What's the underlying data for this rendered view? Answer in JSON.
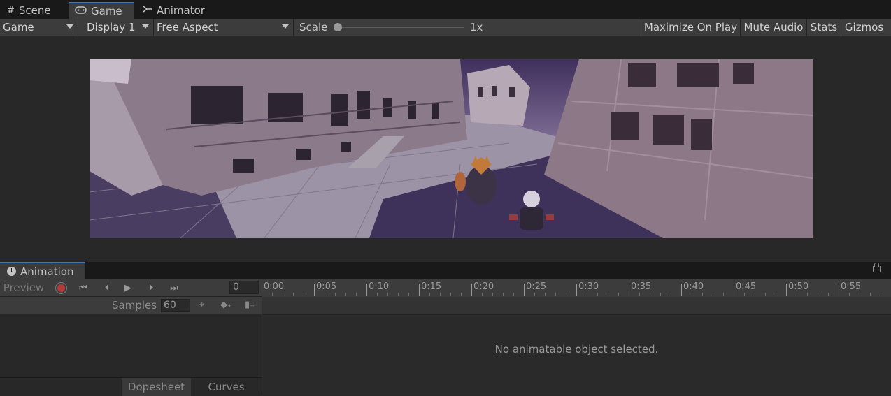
{
  "tabs": [
    {
      "label": "Scene",
      "icon": "grid-icon"
    },
    {
      "label": "Game",
      "icon": "gamepad-icon"
    },
    {
      "label": "Animator",
      "icon": "animator-icon"
    }
  ],
  "toolbar": {
    "game_dropdown": "Game",
    "display_dropdown": "Display 1",
    "aspect_dropdown": "Free Aspect",
    "scale_label": "Scale",
    "scale_value": "1x",
    "scale_level": 0.0,
    "maximize_label": "Maximize On Play",
    "mute_label": "Mute Audio",
    "stats_label": "Stats",
    "gizmos_label": "Gizmos"
  },
  "animation": {
    "tab_label": "Animation",
    "preview_label": "Preview",
    "frame_value": "0",
    "samples_label": "Samples",
    "samples_value": "60",
    "ticks": [
      "0:00",
      "0:05",
      "0:10",
      "0:15",
      "0:20",
      "0:25",
      "0:30",
      "0:35",
      "0:40",
      "0:45",
      "0:50",
      "0:55"
    ],
    "empty_message": "No animatable object selected.",
    "dopesheet_label": "Dopesheet",
    "curves_label": "Curves"
  },
  "colors": {
    "accent": "#3a79bb",
    "record": "#b33a3a",
    "background": "#282828"
  }
}
